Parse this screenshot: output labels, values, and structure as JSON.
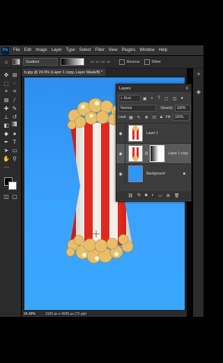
{
  "menubar": {
    "logo": "Ps",
    "items": [
      "File",
      "Edit",
      "Image",
      "Layer",
      "Type",
      "Select",
      "Filter",
      "View",
      "Plugins",
      "Window",
      "Help"
    ]
  },
  "options": {
    "preset": "Gradient",
    "reverse_label": "Reverse",
    "dither_label": "Dither"
  },
  "document": {
    "tab_title": "b.jpg @ 24.5% (Layer 1 copy, Layer Mask/8) *",
    "zoom": "24.49%",
    "info": "3150 px x 4565 px (72 ppi)"
  },
  "layers_panel": {
    "title": "Layers",
    "filter_kind": "Kind",
    "blend_mode": "Normal",
    "opacity_label": "Opacity:",
    "opacity_value": "100%",
    "lock_label": "Lock:",
    "fill_label": "Fill:",
    "fill_value": "100%",
    "layers": [
      {
        "name": "Layer 1"
      },
      {
        "name": "Layer 1 copy"
      },
      {
        "name": "Background"
      }
    ]
  },
  "colors": {
    "canvas_top": "#2f8ff0",
    "canvas_bottom": "#3aa7ff",
    "stripe_red": "#e0281f",
    "stripe_white": "#f4efe9",
    "popcorn": "#e7bf6b"
  },
  "icons": [
    "home-icon",
    "move-tool-icon",
    "marquee-tool-icon",
    "lasso-tool-icon",
    "crop-tool-icon",
    "eyedropper-icon",
    "brush-icon",
    "eraser-icon",
    "gradient-tool-icon",
    "pen-tool-icon",
    "type-tool-icon",
    "hand-tool-icon",
    "zoom-tool-icon",
    "eye-icon",
    "link-icon",
    "lock-icon",
    "trash-icon",
    "fx-icon",
    "mask-icon",
    "new-layer-icon",
    "folder-icon"
  ]
}
